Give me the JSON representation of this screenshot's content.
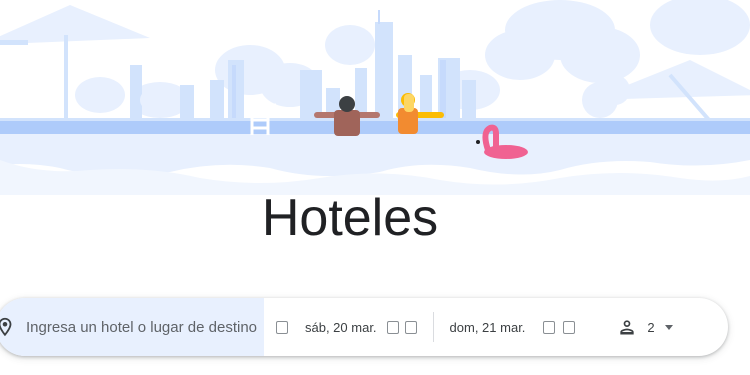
{
  "page": {
    "title": "Hoteles"
  },
  "search": {
    "placeholder": "Ingresa un hotel o lugar de destino",
    "check_in": "sáb, 20 mar.",
    "check_out": "dom, 21 mar.",
    "guests": "2"
  },
  "icons": {
    "location": "location-pin-icon",
    "calendar": "calendar-icon",
    "nav": "chevron-icon",
    "guests": "person-icon",
    "dropdown": "dropdown-caret-icon"
  },
  "colors": {
    "illustration_pale": "#e8f0fe",
    "illustration_mid": "#c6dafc",
    "pool": "#aecbfa",
    "location_field_bg": "#e8f0fe",
    "flamingo": "#f06292"
  }
}
